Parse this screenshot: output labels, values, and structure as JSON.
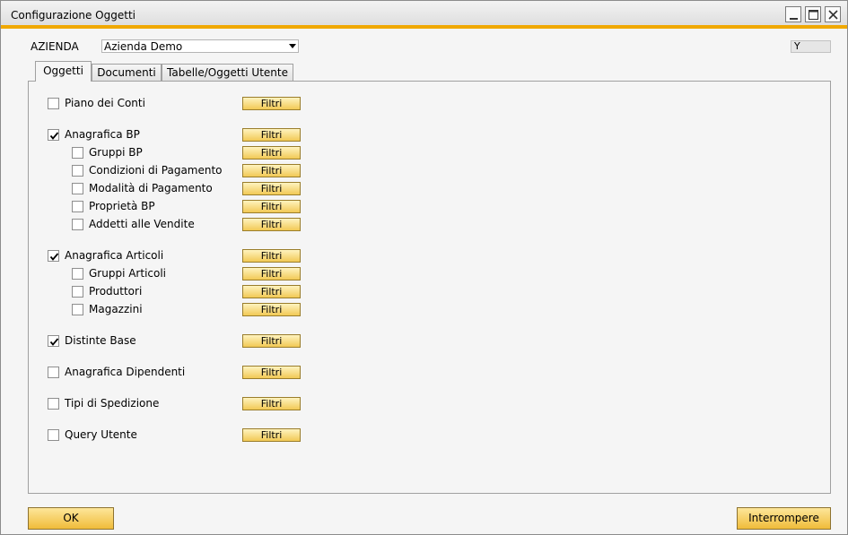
{
  "window": {
    "title": "Configurazione Oggetti"
  },
  "header": {
    "company_label": "AZIENDA",
    "company_value": "Azienda Demo",
    "y_field_value": "Y"
  },
  "tabs": [
    {
      "label": "Oggetti",
      "active": true
    },
    {
      "label": "Documenti",
      "active": false
    },
    {
      "label": "Tabelle/Oggetti Utente",
      "active": false
    }
  ],
  "filter_label": "Filtri",
  "objects": [
    {
      "label": "Piano dei Conti",
      "checked": false,
      "level": 0
    },
    {
      "label": "Anagrafica BP",
      "checked": true,
      "level": 0
    },
    {
      "label": "Gruppi BP",
      "checked": false,
      "level": 1
    },
    {
      "label": "Condizioni di Pagamento",
      "checked": false,
      "level": 1
    },
    {
      "label": "Modalità di Pagamento",
      "checked": false,
      "level": 1
    },
    {
      "label": "Proprietà BP",
      "checked": false,
      "level": 1
    },
    {
      "label": "Addetti alle Vendite",
      "checked": false,
      "level": 1
    },
    {
      "label": "Anagrafica Articoli",
      "checked": true,
      "level": 0
    },
    {
      "label": "Gruppi Articoli",
      "checked": false,
      "level": 1
    },
    {
      "label": "Produttori",
      "checked": false,
      "level": 1
    },
    {
      "label": "Magazzini",
      "checked": false,
      "level": 1
    },
    {
      "label": "Distinte Base",
      "checked": true,
      "level": 0
    },
    {
      "label": "Anagrafica Dipendenti",
      "checked": false,
      "level": 0
    },
    {
      "label": "Tipi di Spedizione",
      "checked": false,
      "level": 0
    },
    {
      "label": "Query Utente",
      "checked": false,
      "level": 0
    }
  ],
  "footer": {
    "ok_label": "OK",
    "cancel_label": "Interrompere"
  },
  "colors": {
    "accent_stripe": "#f0a800",
    "button_fill": "#f2c955"
  }
}
